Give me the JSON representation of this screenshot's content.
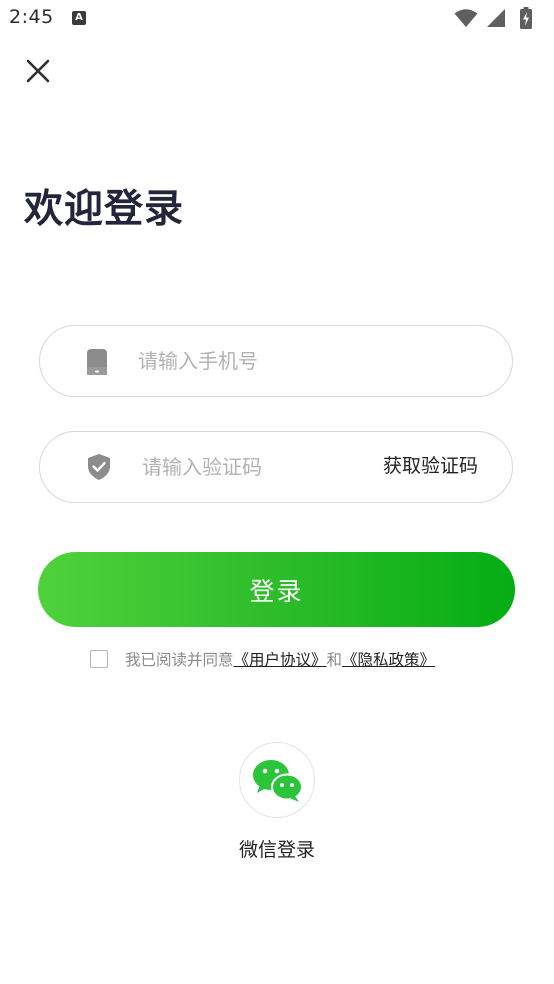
{
  "status_bar": {
    "time": "2:45",
    "notification_glyph": "A",
    "icons": [
      "wifi-icon",
      "signal-icon",
      "battery-charging-icon"
    ]
  },
  "header": {
    "close_icon": "close-icon"
  },
  "title": "欢迎登录",
  "form": {
    "phone": {
      "icon": "phone-icon",
      "placeholder": "请输入手机号",
      "value": ""
    },
    "code": {
      "icon": "shield-check-icon",
      "placeholder": "请输入验证码",
      "value": "",
      "get_code_label": "获取验证码"
    },
    "login_label": "登录"
  },
  "agreement": {
    "checked": false,
    "prefix": "我已阅读并同意",
    "user_agreement": "《用户协议》",
    "conjunction": "和",
    "privacy_policy": "《隐私政策》"
  },
  "wechat": {
    "icon": "wechat-icon",
    "label": "微信登录"
  },
  "colors": {
    "brand_green_start": "#4fd23c",
    "brand_green_end": "#05ad14",
    "wechat_green": "#2bc43a",
    "title": "#23263a",
    "placeholder": "#b2b2b2"
  }
}
